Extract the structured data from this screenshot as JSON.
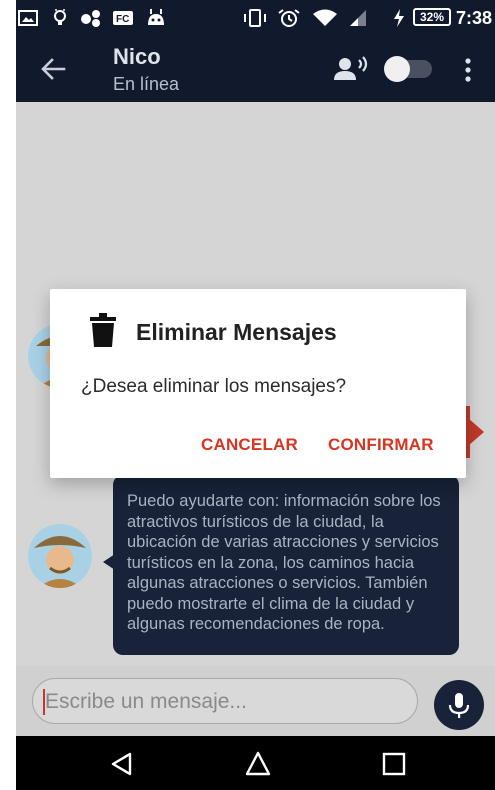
{
  "status_bar": {
    "battery": "32%",
    "time": "7:38"
  },
  "header": {
    "title": "Nico",
    "subtitle": "En línea"
  },
  "chat": {
    "bot_message": "Puedo ayudarte con: información sobre los atractivos turísticos de la ciudad, la ubicación de varias atracciones y servicios turísticos en la zona, los caminos hacia algunas atracciones o servicios. También puedo mostrarte el clima de la ciudad y algunas recomendaciones de ropa."
  },
  "composer": {
    "placeholder": "Escribe un mensaje..."
  },
  "dialog": {
    "title": "Eliminar Mensajes",
    "message": "¿Desea eliminar los mensajes?",
    "cancel_label": "CANCELAR",
    "confirm_label": "CONFIRMAR"
  },
  "colors": {
    "primary_dark": "#111a2d",
    "bubble": "#182238",
    "accent": "#d9341f"
  },
  "icons": [
    "back-arrow-icon",
    "speaker-icon",
    "toggle-switch",
    "more-vert-icon",
    "trash-icon",
    "mic-icon",
    "nav-back-icon",
    "nav-home-icon",
    "nav-recents-icon"
  ]
}
